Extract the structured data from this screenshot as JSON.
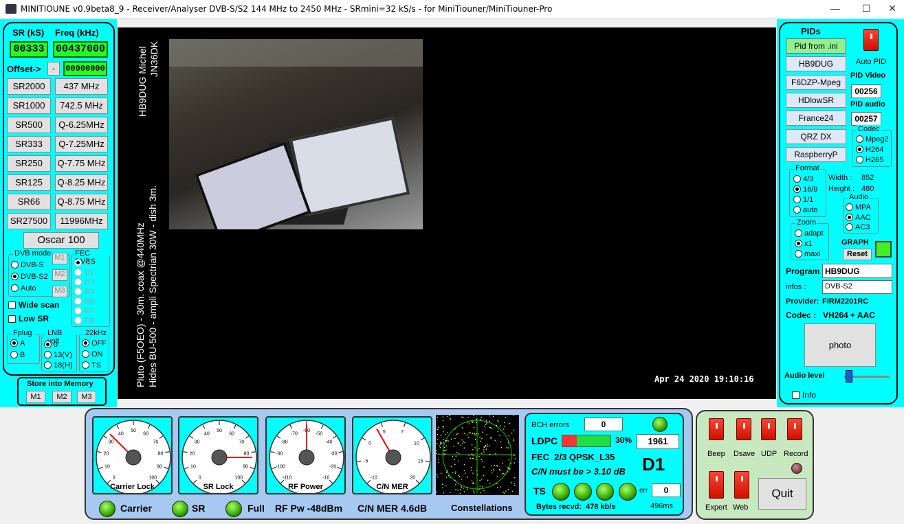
{
  "window": {
    "title": "MINITIOUNE v0.9beta8_9 - Receiver/Analyser DVB-S/S2 144 MHz to 2450 MHz - SRmini=32 kS/s - for MiniTiouner/MiniTiouner-Pro",
    "minimize": "—",
    "maximize": "☐",
    "close": "✕"
  },
  "left": {
    "sr_header": "SR (kS)",
    "freq_header": "Freq (kHz)",
    "sr_value": "00333",
    "freq_value": "00437000",
    "offset_label": "Offset->",
    "offset_sign": "-",
    "offset_value": "00000000",
    "sr_buttons": [
      "SR2000",
      "SR1000",
      "SR500",
      "SR333",
      "SR250",
      "SR125",
      "SR66",
      "SR27500"
    ],
    "freq_buttons": [
      "437 MHz",
      "742.5 MHz",
      "Q-6.25MHz",
      "Q-7.25MHz",
      "Q-7.75 MHz",
      "Q-8.25 MHz",
      "Q-8.75 MHz",
      "11996MHz"
    ],
    "oscar": "Oscar 100",
    "dvb_mode": {
      "title": "DVB mode",
      "options": [
        "DVB-S",
        "DVB-S2",
        "Auto"
      ]
    },
    "m_buttons": [
      "M1",
      "M2",
      "M3"
    ],
    "fec": {
      "title": "FEC DVBS",
      "options": [
        "All",
        "1/2",
        "2/3",
        "3/4",
        "5/6",
        "6/7",
        "7/8"
      ]
    },
    "wide_scan": "Wide scan",
    "low_sr": "Low SR",
    "fplug": {
      "title": "Fplug",
      "options": [
        "A",
        "B"
      ]
    },
    "lnb": {
      "title": "LNB volt",
      "options": [
        "0",
        "13(V)",
        "18(H)"
      ]
    },
    "khz": {
      "title": "22kHz",
      "options": [
        "OFF",
        "ON",
        "TS"
      ]
    },
    "store": {
      "title": "Store into Memory",
      "buttons": [
        "M1",
        "M2",
        "M3"
      ]
    }
  },
  "video": {
    "overlay1": "HB9DUG Michel",
    "overlay2": "JN36DK",
    "overlay3": "Pluto (F5OEO) - 30m. coax @440MHz",
    "overlay4": "Hides BU-500 - ampli Spectrian 30W - dish 3m.",
    "timestamp": "Apr 24 2020 19:10:16"
  },
  "right": {
    "pids_title": "PIDs",
    "auto_pid": "Auto PID",
    "buttons": [
      "Pid from .ini",
      "HB9DUG",
      "F6DZP-Mpeg",
      "HDlowSR",
      "France24",
      "QRZ DX",
      "RaspberryP"
    ],
    "pid_video_label": "PID Video",
    "pid_video": "00256",
    "pid_audio_label": "PID audio",
    "pid_audio": "00257",
    "codec": {
      "title": "Codec",
      "options": [
        "Mpeg2",
        "H264",
        "H265"
      ]
    },
    "format": {
      "title": "Format",
      "options": [
        "4/3",
        "16/9",
        "1/1",
        "auto"
      ]
    },
    "width_label": "Width :",
    "width": "852",
    "height_label": "Height :",
    "height": "480",
    "audio": {
      "title": "Audio",
      "options": [
        "MPA",
        "AAC",
        "AC3"
      ]
    },
    "zoom": {
      "title": "Zoom",
      "options": [
        "adapt",
        "x1",
        "maxi"
      ]
    },
    "graph": "GRAPH",
    "reset": "Reset",
    "program_label": "Program",
    "program": "HB9DUG",
    "infos_label": "infos :",
    "infos": "DVB-S2",
    "provider_label": "Provider:",
    "provider": "FIRM2201RC",
    "codec_label": "Codec :",
    "codec_value": "VH264 + AAC",
    "photo": "photo",
    "audio_level": "Audio level",
    "info": "Info"
  },
  "bottom": {
    "gauges": [
      {
        "label": "Carrier Lock",
        "ticks": [
          "0",
          "10",
          "20",
          "30",
          "40",
          "50",
          "60",
          "70",
          "80",
          "90",
          "100"
        ]
      },
      {
        "label": "SR Lock",
        "ticks": [
          "0",
          "10",
          "20",
          "30",
          "40",
          "50",
          "60",
          "70",
          "80",
          "90",
          "100"
        ]
      },
      {
        "label": "RF Power",
        "ticks": [
          "-110",
          "-100",
          "-90",
          "-80",
          "-70",
          "-60",
          "-50",
          "-40",
          "-30",
          "-20",
          "-10"
        ]
      },
      {
        "label": "C/N MER",
        "ticks": [
          "-10",
          "-5",
          "0",
          "5",
          "7",
          "10",
          "15",
          "20"
        ]
      }
    ],
    "carrier": "Carrier",
    "sr": "SR",
    "full": "Full",
    "rf_pw": "RF Pw -48dBm",
    "cn_mer": "C/N MER 4.6dB",
    "constellations": "Constellations",
    "bch_label": "BCH errors",
    "bch": "0",
    "ldpc_label": "LDPC",
    "ldpc_pct": "30%",
    "ldpc_fraction": 0.3,
    "ldpc_value": "1961",
    "fec": "FEC  2/3 QPSK_L35",
    "cn_must": "C/N must be > 3.10 dB",
    "d1": "D1",
    "ts": "TS",
    "err_label": "err",
    "err": "0",
    "bytes": "Bytes recvd:  478 kb/s",
    "ms": "496ms"
  },
  "controls": {
    "switches": [
      "Beep",
      "Dsave",
      "UDP",
      "Record"
    ],
    "switches2": [
      "Expert",
      "Web"
    ],
    "quit": "Quit"
  }
}
